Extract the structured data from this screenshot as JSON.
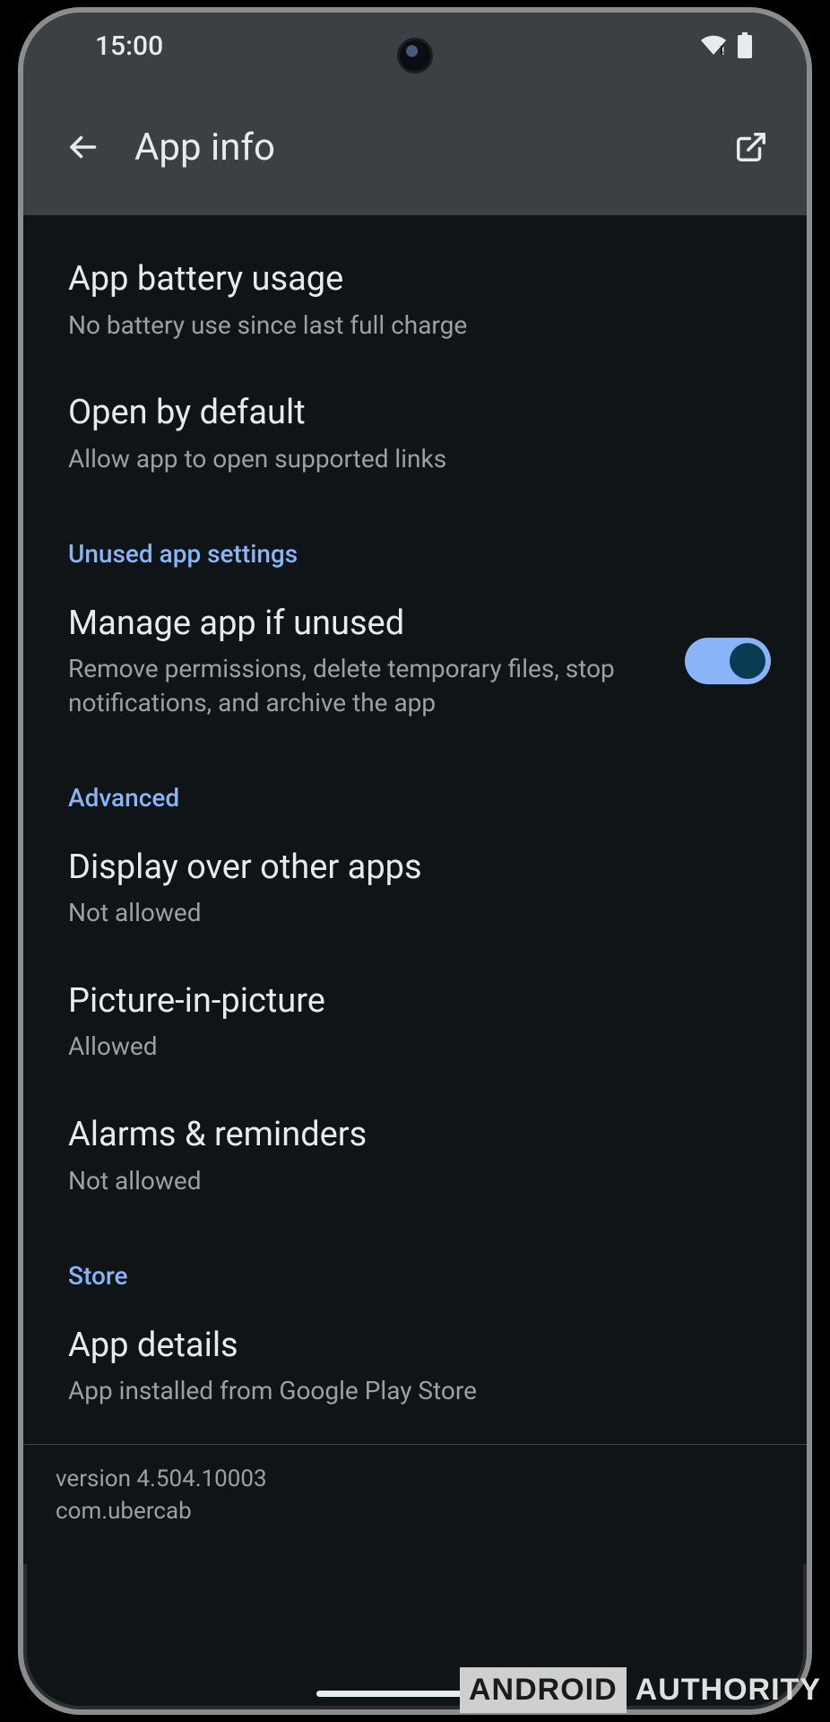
{
  "status": {
    "time": "15:00"
  },
  "header": {
    "title": "App info"
  },
  "items": {
    "battery": {
      "title": "App battery usage",
      "subtitle": "No battery use since last full charge"
    },
    "open": {
      "title": "Open by default",
      "subtitle": "Allow app to open supported links"
    },
    "manage": {
      "title": "Manage app if unused",
      "subtitle": "Remove permissions, delete temporary files, stop notifications, and archive the app",
      "enabled": true
    },
    "overlay": {
      "title": "Display over other apps",
      "subtitle": "Not allowed"
    },
    "pip": {
      "title": "Picture-in-picture",
      "subtitle": "Allowed"
    },
    "alarms": {
      "title": "Alarms & reminders",
      "subtitle": "Not allowed"
    },
    "details": {
      "title": "App details",
      "subtitle": "App installed from Google Play Store"
    }
  },
  "sections": {
    "unused": "Unused app settings",
    "advanced": "Advanced",
    "store": "Store"
  },
  "footer": {
    "version": "version 4.504.10003",
    "package": "com.ubercab"
  },
  "watermark": {
    "boxed": "ANDROID",
    "plain": "AUTHORITY"
  }
}
